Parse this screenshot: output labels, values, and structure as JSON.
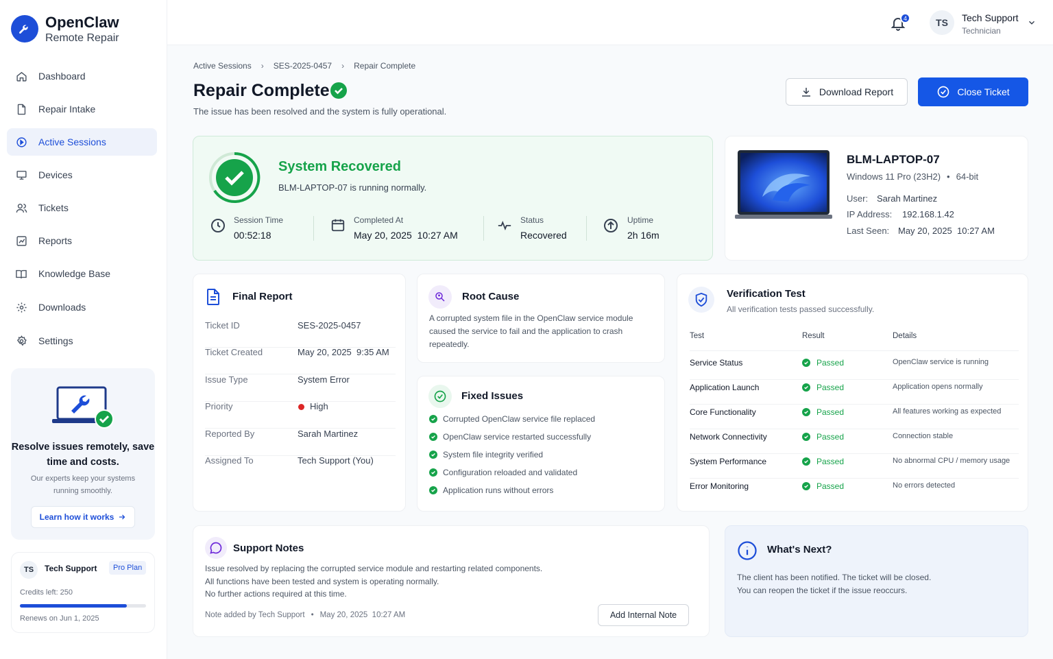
{
  "app": {
    "name": "OpenClaw",
    "subtitle": "Remote Repair"
  },
  "sidebar": {
    "items": [
      {
        "label": "Dashboard",
        "icon": "home-icon"
      },
      {
        "label": "Repair Intake",
        "icon": "file-icon"
      },
      {
        "label": "Active Sessions",
        "icon": "play-circle-icon",
        "active": true
      },
      {
        "label": "Devices",
        "icon": "monitor-icon"
      },
      {
        "label": "Tickets",
        "icon": "users-icon"
      },
      {
        "label": "Reports",
        "icon": "chart-icon"
      },
      {
        "label": "Knowledge Base",
        "icon": "book-icon"
      },
      {
        "label": "Downloads",
        "icon": "gear-icon"
      },
      {
        "label": "Settings",
        "icon": "gear-icon"
      }
    ],
    "promo": {
      "title": "Resolve issues remotely, save time and costs.",
      "subtitle": "Our experts keep your systems running smoothly.",
      "link": "Learn how it works"
    },
    "plan": {
      "initials": "TS",
      "name": "Tech Support",
      "plan": "Pro Plan",
      "credits": "Credits left: 250",
      "credits_fraction": 0.85,
      "renews": "Renews on Jun 1, 2025"
    }
  },
  "header": {
    "notification_count": "4",
    "user": {
      "initials": "TS",
      "name": "Tech Support",
      "role": "Technician"
    }
  },
  "breadcrumb": [
    "Active Sessions",
    "SES-2025-0457",
    "Repair Complete"
  ],
  "page": {
    "title": "Repair Complete",
    "subtitle": "The issue has been resolved and the system is fully operational.",
    "download_label": "Download Report",
    "close_label": "Close Ticket"
  },
  "recovery": {
    "title": "System Recovered",
    "subtitle": "BLM-LAPTOP-07 is running normally.",
    "stats": [
      {
        "label": "Session Time",
        "value": "00:52:18",
        "icon": "clock-icon"
      },
      {
        "label": "Completed At",
        "value": "May 20, 2025  10:27 AM",
        "icon": "calendar-icon"
      },
      {
        "label": "Status",
        "value": "Recovered",
        "icon": "pulse-icon"
      },
      {
        "label": "Uptime",
        "value": "2h 16m",
        "icon": "arrow-up-circle-icon"
      }
    ]
  },
  "device": {
    "name": "BLM-LAPTOP-07",
    "os": "Windows 11 Pro (23H2)",
    "arch": "64-bit",
    "user_label": "User:",
    "user": "Sarah Martinez",
    "ip_label": "IP Address:",
    "ip": "192.168.1.42",
    "seen_label": "Last Seen:",
    "seen": "May 20, 2025  10:27 AM"
  },
  "final_report": {
    "title": "Final Report",
    "rows": [
      {
        "label": "Ticket ID",
        "value": "SES-2025-0457"
      },
      {
        "label": "Ticket Created",
        "value": "May 20, 2025  9:35 AM"
      },
      {
        "label": "Issue Type",
        "value": "System Error"
      },
      {
        "label": "Priority",
        "value": "High"
      },
      {
        "label": "Reported By",
        "value": "Sarah Martinez"
      },
      {
        "label": "Assigned To",
        "value": "Tech Support (You)"
      }
    ]
  },
  "root_cause": {
    "title": "Root Cause",
    "text": "A corrupted system file in the OpenClaw service module caused the service to fail and the application to crash repeatedly."
  },
  "fixed_issues": {
    "title": "Fixed Issues",
    "items": [
      "Corrupted OpenClaw service file replaced",
      "OpenClaw service restarted successfully",
      "System file integrity verified",
      "Configuration reloaded and validated",
      "Application runs without errors"
    ]
  },
  "verification": {
    "title": "Verification Test",
    "subtitle": "All verification tests passed successfully.",
    "columns": [
      "Test",
      "Result",
      "Details"
    ],
    "rows": [
      {
        "test": "Service Status",
        "result": "Passed",
        "details": "OpenClaw service is running"
      },
      {
        "test": "Application Launch",
        "result": "Passed",
        "details": "Application opens normally"
      },
      {
        "test": "Core Functionality",
        "result": "Passed",
        "details": "All features working as expected"
      },
      {
        "test": "Network Connectivity",
        "result": "Passed",
        "details": "Connection stable"
      },
      {
        "test": "System Performance",
        "result": "Passed",
        "details": "No abnormal CPU / memory usage"
      },
      {
        "test": "Error Monitoring",
        "result": "Passed",
        "details": "No errors detected"
      }
    ]
  },
  "support_notes": {
    "title": "Support Notes",
    "lines": [
      "Issue resolved by replacing the corrupted service module and restarting related components.",
      "All functions have been tested and system is operating normally.",
      "No further actions required at this time."
    ],
    "author": "Note added by Tech Support",
    "date": "May 20, 2025  10:27 AM",
    "button": "Add Internal Note"
  },
  "whats_next": {
    "title": "What's Next?",
    "lines": [
      "The client has been notified. The ticket will be closed.",
      "You can reopen the ticket if the issue reoccurs."
    ]
  },
  "colors": {
    "accent": "#1d4ed8",
    "success": "#16a34a",
    "danger": "#dc2626",
    "success_bg": "#f0faf4"
  }
}
